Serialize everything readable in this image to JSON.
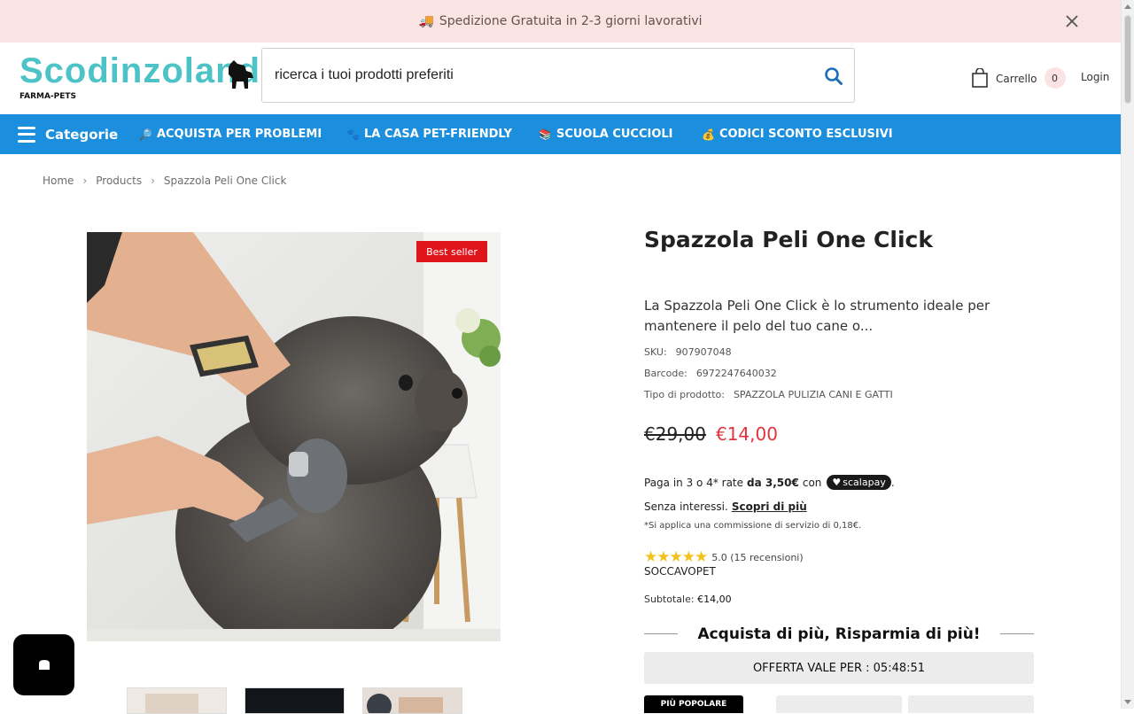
{
  "announcement": {
    "icon": "truck-icon",
    "emoji": "🚚",
    "text": "Spedizione Gratuita in 2-3 giorni lavorativi"
  },
  "header": {
    "logo_text": "Scodinzolando",
    "logo_sub": "FARMA-PETS",
    "search_placeholder": "ricerca i tuoi prodotti preferiti",
    "cart_label": "Carrello",
    "cart_count": "0",
    "login_label": "Login"
  },
  "nav": {
    "categories_label": "Categorie",
    "items": [
      {
        "emoji": "🔎",
        "label": "ACQUISTA PER PROBLEMI"
      },
      {
        "emoji": "🐾",
        "label": "LA CASA PET-FRIENDLY"
      },
      {
        "emoji": "📚",
        "label": "SCUOLA CUCCIOLI"
      },
      {
        "emoji": "💰",
        "label": "CODICI SCONTO ESCLUSIVI"
      }
    ]
  },
  "breadcrumb": [
    "Home",
    "Products",
    "Spazzola Peli One Click"
  ],
  "product": {
    "badge": "Best seller",
    "title": "Spazzola Peli One Click",
    "description": "La Spazzola Peli One Click è lo strumento ideale per mantenere il pelo del tuo cane o...",
    "sku_label": "SKU:",
    "sku": "907907048",
    "barcode_label": "Barcode:",
    "barcode": "6972247640032",
    "type_label": "Tipo di prodotto:",
    "type": "SPAZZOLA PULIZIA CANI E GATTI",
    "price_old": "€29,00",
    "price_new": "€14,00",
    "scalapay": {
      "prefix": "Paga in 3 o 4* rate",
      "amount": "da 3,50€",
      "con": "con",
      "brand": "scalapay",
      "suffix": ".",
      "senza": "Senza interessi.",
      "link": "Scopri di più",
      "note": "*Si applica una commissione di servizio di 0,18€."
    },
    "rating_stars": "★★★★★",
    "rating_text": "5.0 (15 recensioni)",
    "rating_value": 5.0,
    "vendor": "SOCCAVOPET",
    "subtotal_label": "Subtotale:",
    "subtotal": "€14,00",
    "bundle_title": "Acquista di più, Risparmia di più!",
    "offer_text": "OFFERTA VALE PER : 05:48:51",
    "tab_popular": "PIÙ POPOLARE"
  },
  "colors": {
    "nav_blue": "#1b8fdd",
    "badge_red": "#e0141b",
    "price_red": "#e0333b",
    "announce_bg": "#fae3e3",
    "logo_teal": "#4ec3c7"
  }
}
